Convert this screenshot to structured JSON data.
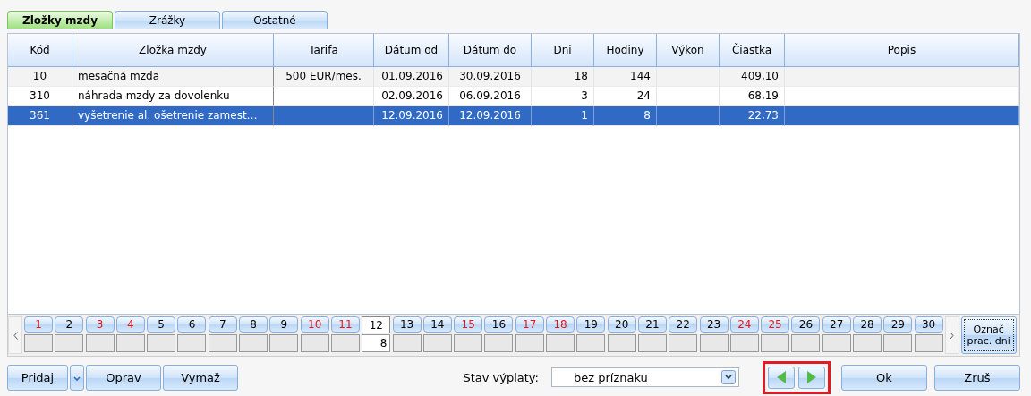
{
  "tabs": [
    {
      "label": "Zložky mzdy",
      "selected": true
    },
    {
      "label": "Zrážky",
      "selected": false
    },
    {
      "label": "Ostatné",
      "selected": false
    }
  ],
  "table": {
    "columns": [
      "Kód",
      "Zložka mzdy",
      "Tarifa",
      "Dátum od",
      "Dátum do",
      "Dni",
      "Hodiny",
      "Výkon",
      "Čiastka",
      "Popis"
    ],
    "rows": [
      {
        "selected": false,
        "cells": [
          "10",
          "mesačná mzda",
          "500 EUR/mes.",
          "01.09.2016",
          "30.09.2016",
          "18",
          "144",
          "",
          "409,10",
          ""
        ]
      },
      {
        "selected": false,
        "cells": [
          "310",
          "náhrada mzdy za dovolenku",
          "",
          "02.09.2016",
          "06.09.2016",
          "3",
          "24",
          "",
          "68,19",
          ""
        ]
      },
      {
        "selected": true,
        "cells": [
          "361",
          "vyšetrenie al. ošetrenie zamest…",
          "",
          "12.09.2016",
          "12.09.2016",
          "1",
          "8",
          "",
          "22,73",
          ""
        ]
      }
    ]
  },
  "days": [
    {
      "label": "1",
      "weekend": true,
      "selected": false
    },
    {
      "label": "2",
      "weekend": false,
      "selected": false
    },
    {
      "label": "3",
      "weekend": true,
      "selected": false
    },
    {
      "label": "4",
      "weekend": true,
      "selected": false
    },
    {
      "label": "5",
      "weekend": false,
      "selected": false
    },
    {
      "label": "6",
      "weekend": false,
      "selected": false
    },
    {
      "label": "7",
      "weekend": false,
      "selected": false
    },
    {
      "label": "8",
      "weekend": false,
      "selected": false
    },
    {
      "label": "9",
      "weekend": false,
      "selected": false
    },
    {
      "label": "10",
      "weekend": true,
      "selected": false
    },
    {
      "label": "11",
      "weekend": true,
      "selected": false
    },
    {
      "label": "12",
      "weekend": false,
      "selected": true,
      "value": "8"
    },
    {
      "label": "13",
      "weekend": false,
      "selected": false
    },
    {
      "label": "14",
      "weekend": false,
      "selected": false
    },
    {
      "label": "15",
      "weekend": true,
      "selected": false
    },
    {
      "label": "16",
      "weekend": false,
      "selected": false
    },
    {
      "label": "17",
      "weekend": true,
      "selected": false
    },
    {
      "label": "18",
      "weekend": true,
      "selected": false
    },
    {
      "label": "19",
      "weekend": false,
      "selected": false
    },
    {
      "label": "20",
      "weekend": false,
      "selected": false
    },
    {
      "label": "21",
      "weekend": false,
      "selected": false
    },
    {
      "label": "22",
      "weekend": false,
      "selected": false
    },
    {
      "label": "23",
      "weekend": false,
      "selected": false
    },
    {
      "label": "24",
      "weekend": true,
      "selected": false
    },
    {
      "label": "25",
      "weekend": true,
      "selected": false
    },
    {
      "label": "26",
      "weekend": false,
      "selected": false
    },
    {
      "label": "27",
      "weekend": false,
      "selected": false
    },
    {
      "label": "28",
      "weekend": false,
      "selected": false
    },
    {
      "label": "29",
      "weekend": false,
      "selected": false
    },
    {
      "label": "30",
      "weekend": false,
      "selected": false
    }
  ],
  "mark_days_button": {
    "label": "Označ prac. dni"
  },
  "left_buttons": [
    {
      "label": "Pridaj",
      "underline_first": true,
      "dropdown": true
    },
    {
      "label": "Oprav",
      "underline_first": false,
      "dropdown": false
    },
    {
      "label": "Vymaž",
      "underline_first": true,
      "dropdown": false
    }
  ],
  "status": {
    "label": "Stav výplaty:",
    "value": "bez príznaku"
  },
  "nav_highlighted": true,
  "right_buttons": [
    {
      "label": "Ok",
      "underline_first": true
    },
    {
      "label": "Zruš",
      "underline_first": true
    }
  ]
}
